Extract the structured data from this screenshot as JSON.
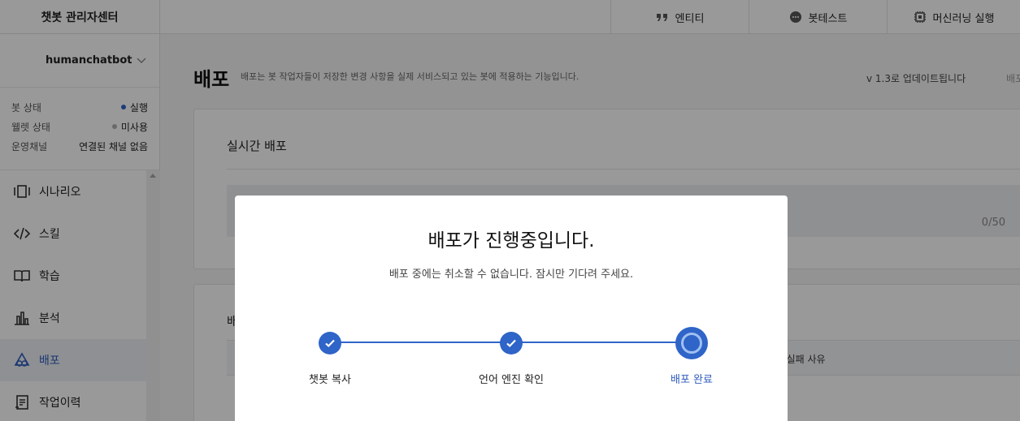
{
  "header": {
    "brand": "챗봇 관리자센터",
    "nav": [
      {
        "label": "엔티티",
        "icon": "quote-icon"
      },
      {
        "label": "봇테스트",
        "icon": "chat-bubble-icon"
      },
      {
        "label": "머신러닝 실행",
        "icon": "chip-icon"
      }
    ]
  },
  "sidebar": {
    "bot_name": "humanchatbot",
    "status": [
      {
        "key": "봇 상태",
        "value": "실행",
        "dot_color": "#2f64c8"
      },
      {
        "key": "웰렛 상태",
        "value": "미사용",
        "dot_color": "#b0b0b0"
      },
      {
        "key": "운영채널",
        "value": "연결된 채널 없음",
        "dot_color": ""
      }
    ],
    "menu": [
      {
        "label": "시나리오",
        "icon": "scenario-icon"
      },
      {
        "label": "스킬",
        "icon": "code-icon"
      },
      {
        "label": "학습",
        "icon": "book-icon"
      },
      {
        "label": "분석",
        "icon": "chart-icon"
      },
      {
        "label": "배포",
        "icon": "deploy-icon",
        "active": true
      },
      {
        "label": "작업이력",
        "icon": "history-icon"
      }
    ]
  },
  "page": {
    "title": "배포",
    "description": "배포는 봇 작업자들이 저장한 변경 사항을 실제 서비스되고 있는 봇에 적용하는 기능입니다.",
    "version_note": "v 1.3로 업데이트됩니다",
    "extra": "배포",
    "realtime_card_title": "실시간 배포",
    "char_count": "0/50",
    "history_card_title": "배",
    "history_col_failure": "! 실패 사유"
  },
  "modal": {
    "title": "배포가 진행중입니다.",
    "subtitle": "배포 중에는 취소할 수 없습니다. 잠시만 기다려 주세요.",
    "steps": [
      {
        "label": "챗봇 복사",
        "state": "done"
      },
      {
        "label": "언어 엔진 확인",
        "state": "done"
      },
      {
        "label": "배포 완료",
        "state": "in-progress"
      }
    ],
    "accent": "#2f64c8"
  }
}
